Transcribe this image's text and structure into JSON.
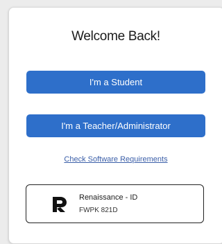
{
  "colors": {
    "button_blue": "#2e6fca",
    "link_blue": "#3a5ea8",
    "text_dark": "#1b1b1b"
  },
  "title": "Welcome Back!",
  "buttons": {
    "student": "I'm a Student",
    "teacher": "I'm a Teacher/Administrator"
  },
  "link": "Check Software Requirements",
  "renaissance_id": {
    "icon": "renaissance-logo-icon",
    "name": "Renaissance - ID",
    "code": "FWPK 821D"
  }
}
